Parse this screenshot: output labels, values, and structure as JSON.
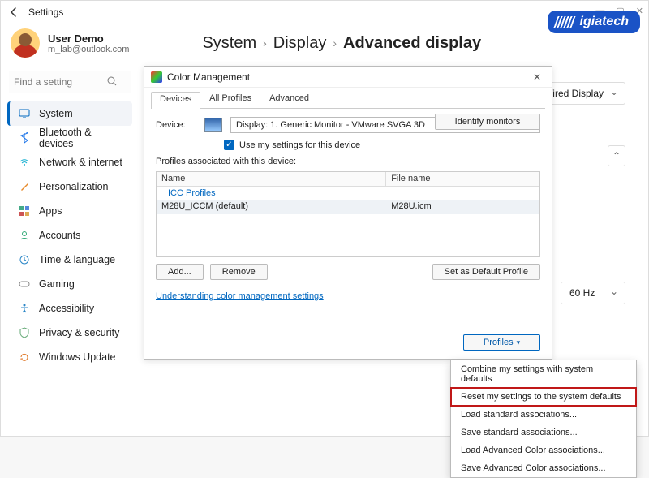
{
  "window": {
    "title": "Settings"
  },
  "brand": "igiatech",
  "user": {
    "name": "User Demo",
    "email": "m_lab@outlook.com"
  },
  "breadcrumbs": {
    "a": "System",
    "b": "Display",
    "c": "Advanced display"
  },
  "search": {
    "placeholder": "Find a setting"
  },
  "nav": {
    "items": [
      "System",
      "Bluetooth & devices",
      "Network & internet",
      "Personalization",
      "Apps",
      "Accounts",
      "Time & language",
      "Gaming",
      "Accessibility",
      "Privacy & security",
      "Windows Update"
    ]
  },
  "right_panel": {
    "wired_label": "Wired Display",
    "refresh_rate": "60 Hz"
  },
  "dialog": {
    "title": "Color Management",
    "tabs": {
      "devices": "Devices",
      "all": "All Profiles",
      "advanced": "Advanced"
    },
    "device_label": "Device:",
    "device_value": "Display: 1. Generic Monitor - VMware SVGA 3D",
    "use_my_settings": "Use my settings for this device",
    "identify": "Identify monitors",
    "assoc_label": "Profiles associated with this device:",
    "columns": {
      "name": "Name",
      "file": "File name"
    },
    "group": "ICC Profiles",
    "rows": [
      {
        "name": "M28U_ICCM (default)",
        "file": "M28U.icm"
      }
    ],
    "buttons": {
      "add": "Add...",
      "remove": "Remove",
      "set_default": "Set as Default Profile",
      "profiles": "Profiles"
    },
    "link": "Understanding color management settings"
  },
  "ctx": {
    "items": [
      "Combine my settings with system defaults",
      "Reset my settings to the system defaults",
      "Load standard associations...",
      "Save standard associations...",
      "Load Advanced Color associations...",
      "Save Advanced Color associations..."
    ]
  }
}
